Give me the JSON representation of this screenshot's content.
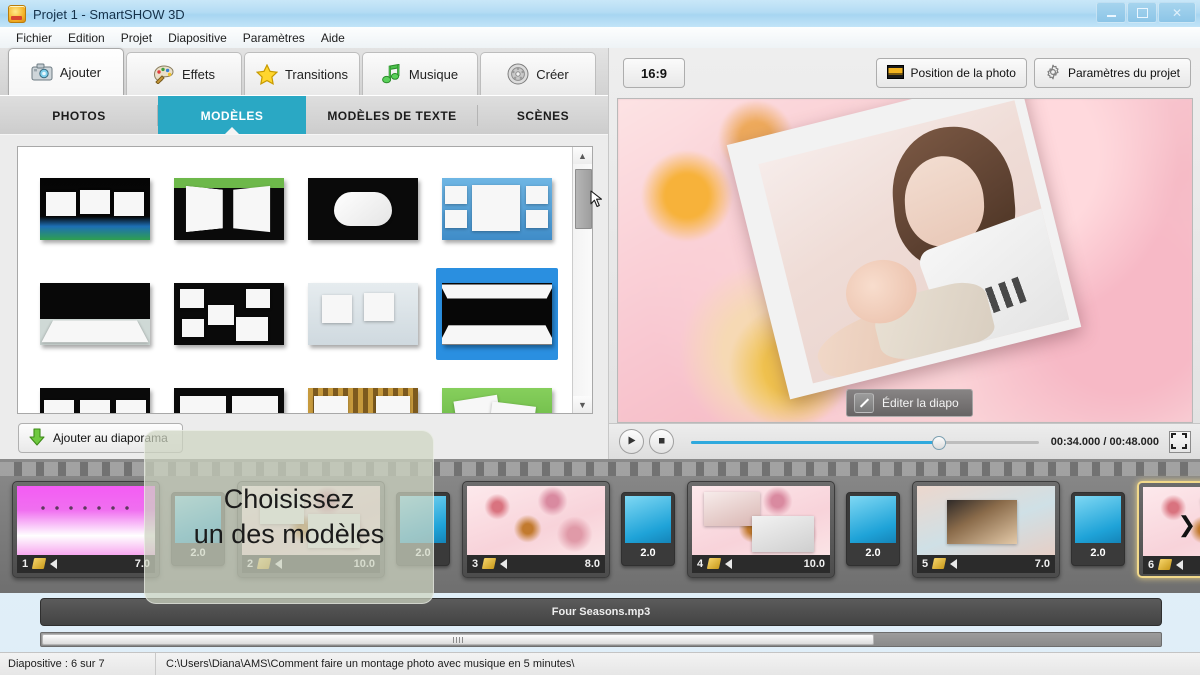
{
  "window": {
    "title": "Projet 1 - SmartSHOW 3D",
    "app_icon": "smartshow-app-icon",
    "minimize": "–",
    "maximize": "□",
    "close": "✕"
  },
  "menubar": {
    "items": [
      "Fichier",
      "Edition",
      "Projet",
      "Diapositive",
      "Paramètres",
      "Aide"
    ]
  },
  "main_tabs": [
    {
      "label": "Ajouter",
      "icon": "camera-icon",
      "active": true
    },
    {
      "label": "Effets",
      "icon": "palette-icon",
      "active": false
    },
    {
      "label": "Transitions",
      "icon": "star-icon",
      "active": false
    },
    {
      "label": "Musique",
      "icon": "music-note-icon",
      "active": false
    },
    {
      "label": "Créer",
      "icon": "disc-icon",
      "active": false
    }
  ],
  "sub_tabs": [
    {
      "label": "PHOTOS",
      "active": false
    },
    {
      "label": "MODÈLES",
      "active": true
    },
    {
      "label": "MODÈLES DE TEXTE",
      "active": false
    },
    {
      "label": "SCÈNES",
      "active": false
    }
  ],
  "templates": {
    "selected_index": 7,
    "items": [
      {
        "style": "three-cards-earth"
      },
      {
        "style": "open-book-green"
      },
      {
        "style": "wavy-card-black"
      },
      {
        "style": "five-cards-blue"
      },
      {
        "style": "floor-panorama-black"
      },
      {
        "style": "scatter-cards-black"
      },
      {
        "style": "two-cards-light"
      },
      {
        "style": "mirror-floor-black"
      },
      {
        "style": "three-cards-row-black"
      },
      {
        "style": "split-pair-black"
      },
      {
        "style": "grid-weave-gold"
      },
      {
        "style": "stack-cards-green"
      }
    ],
    "add_button_label": "Ajouter au diaporama",
    "add_button_icon": "download-arrow-icon"
  },
  "preview": {
    "aspect_ratio": "16:9",
    "photo_position_label": "Position de la photo",
    "photo_position_icon": "photo-position-icon",
    "project_settings_label": "Paramètres du projet",
    "project_settings_icon": "gear-icon",
    "edit_slide_label": "Éditer la diapo",
    "edit_slide_icon": "pencil-icon",
    "play_icon": "play-icon",
    "stop_icon": "stop-icon",
    "fullscreen_icon": "fullscreen-icon",
    "time_display": "00:34.000 / 00:48.000",
    "progress_percent": 71
  },
  "hint_overlay": {
    "line1": "Choisissez",
    "line2": "un des modèles"
  },
  "timeline": {
    "slides": [
      {
        "number": "1",
        "duration": "7.0",
        "art": "art1",
        "selected": false
      },
      {
        "number": "2",
        "duration": "10.0",
        "art": "art-people",
        "selected": false
      },
      {
        "number": "3",
        "duration": "8.0",
        "art": "art-floral",
        "selected": false
      },
      {
        "number": "4",
        "duration": "10.0",
        "art": "art-collage",
        "selected": false
      },
      {
        "number": "5",
        "duration": "7.0",
        "art": "art-baby",
        "selected": false
      },
      {
        "number": "6",
        "duration": "",
        "art": "art-mother",
        "selected": true
      }
    ],
    "transitions": [
      {
        "duration": "2.0"
      },
      {
        "duration": "2.0"
      },
      {
        "duration": "2.0"
      },
      {
        "duration": "2.0"
      },
      {
        "duration": "2.0"
      }
    ],
    "next_arrow_icon": "chevron-right-icon",
    "edit_icon": "pencil-icon",
    "sound_icon": "speaker-icon"
  },
  "music_track": {
    "name": "Four Seasons.mp3"
  },
  "statusbar": {
    "slide_counter": "Diapositive : 6 sur 7",
    "project_path": "C:\\Users\\Diana\\AMS\\Comment faire un montage photo avec musique en 5 minutes\\"
  },
  "colors": {
    "accent_teal": "#2aa8c4",
    "selection_blue": "#2a8fe0",
    "seek_blue": "#2fa9dd",
    "titlebar": "#b4dcf4",
    "selected_slide_border": "#f2d98a"
  }
}
